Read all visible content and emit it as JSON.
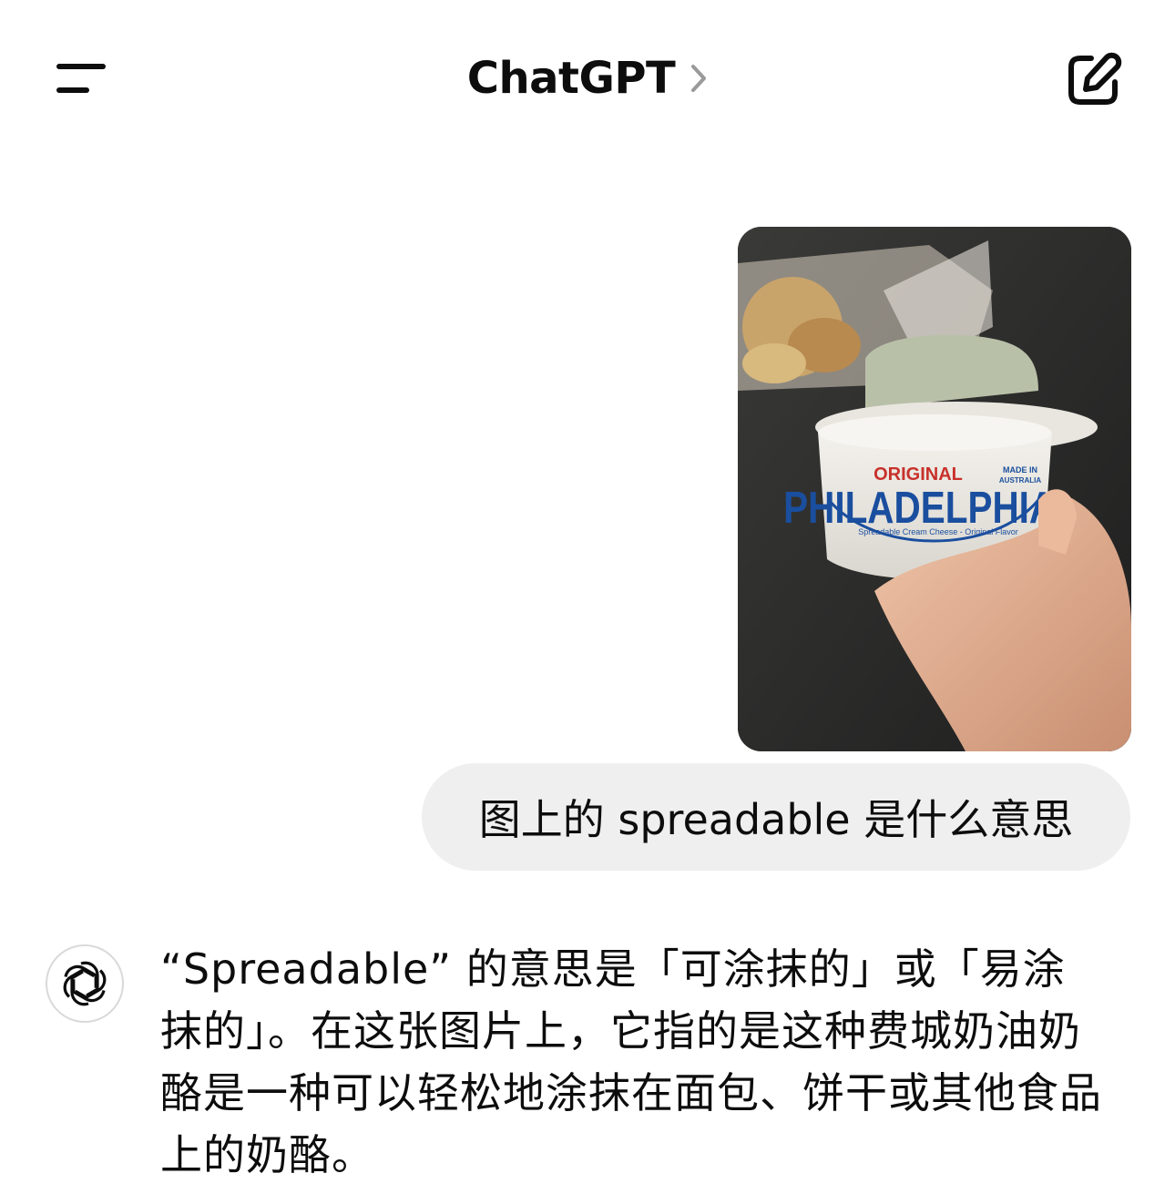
{
  "header": {
    "title": "ChatGPT",
    "menu_icon": "menu-icon",
    "chevron_icon": "chevron-right-icon",
    "new_chat_icon": "new-chat-icon"
  },
  "conversation": {
    "user_message": {
      "image": {
        "product_label_lines": [
          "ORIGINAL",
          "PHILADELPHIA",
          "Spreadable Cream Cheese - Original Flavor",
          "MADE IN AUSTRALIA"
        ]
      },
      "text": "图上的 spreadable 是什么意思"
    },
    "assistant_message": {
      "avatar_icon": "openai-logo-icon",
      "text": "“Spreadable” 的意思是「可涂抹的」或「易涂抹的」。在这张图片上，它指的是这种费城奶油奶酪是一种可以轻松地涂抹在面包、饼干或其他食品上的奶酪。"
    }
  }
}
